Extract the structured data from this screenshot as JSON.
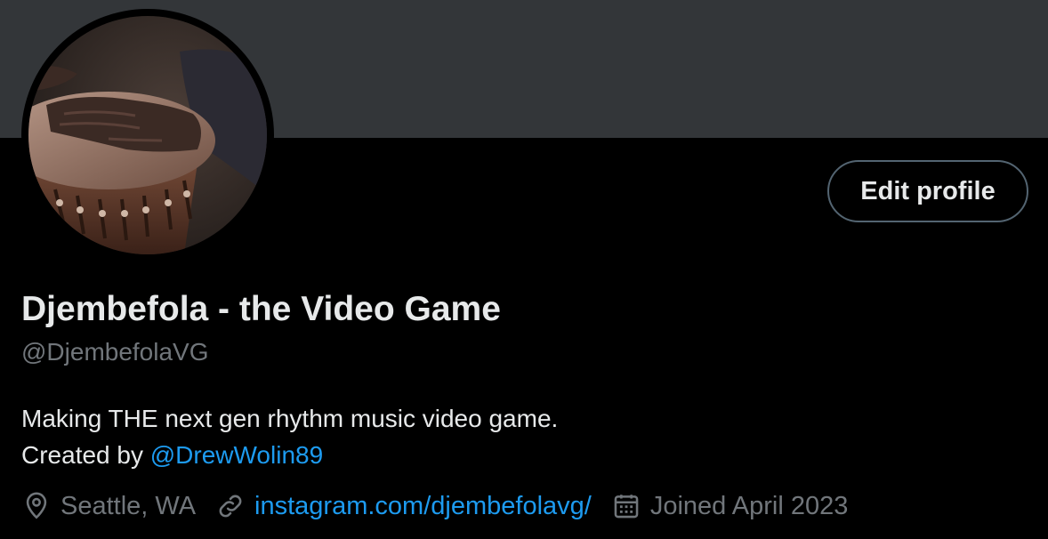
{
  "profile": {
    "display_name": "Djembefola - the Video Game",
    "handle": "@DjembefolaVG",
    "edit_button_label": "Edit profile",
    "bio_line1": "Making THE next gen rhythm music video game.",
    "bio_created_by": "Created by ",
    "bio_mention": "@DrewWolin89",
    "location": "Seattle, WA",
    "website": "instagram.com/djembefolavg/",
    "joined": "Joined April 2023"
  },
  "icons": {
    "location": "location-pin-icon",
    "website": "link-icon",
    "joined": "calendar-icon"
  },
  "colors": {
    "background": "#000000",
    "banner": "#333639",
    "text_primary": "#e7e9ea",
    "text_secondary": "#71767b",
    "link": "#1d9bf0",
    "button_border": "#536471"
  }
}
